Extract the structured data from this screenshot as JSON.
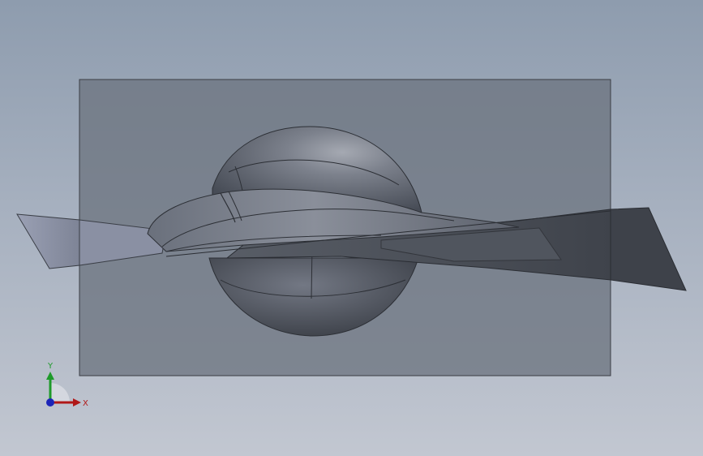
{
  "viewport": {
    "background_top": "#8e9cae",
    "background_bottom": "#c2c7d1"
  },
  "triad": {
    "x_label": "X",
    "y_label": "Y",
    "x_color": "#b01818",
    "y_color": "#1e9a2a",
    "z_color": "#1c24b8"
  },
  "model": {
    "plane_fill": "#6d7480",
    "body_color": "#5e6470",
    "wing_right_color": "#4a4f58",
    "wing_left_color": "#8f96aa"
  }
}
